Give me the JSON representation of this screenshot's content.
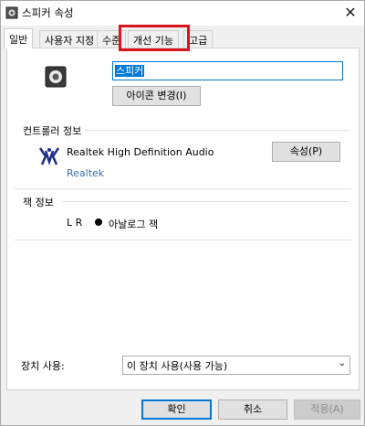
{
  "window": {
    "title": "스피커 속성",
    "close_glyph": "✕"
  },
  "tabs": [
    {
      "label": "일반",
      "active": true
    },
    {
      "label": "사용자 지정"
    },
    {
      "label": "수준"
    },
    {
      "label": "개선 기능",
      "highlighted": true
    },
    {
      "label": "고급"
    }
  ],
  "device": {
    "name_value": "스피커",
    "change_icon_label": "아이콘 변경(I)"
  },
  "controller": {
    "group_label": "컨트롤러 정보",
    "driver_name": "Realtek High Definition Audio",
    "vendor": "Realtek",
    "properties_label": "속성(P)"
  },
  "jack": {
    "group_label": "잭 정보",
    "position": "L R",
    "type": "아날로그 잭"
  },
  "device_usage": {
    "label": "장치 사용:",
    "selected": "이 장치 사용(사용 가능)"
  },
  "buttons": {
    "ok": "확인",
    "cancel": "취소",
    "apply": "적용(A)"
  },
  "colors": {
    "accent": "#0078d7",
    "highlight_border": "#d9141d",
    "vendor_link": "#3b6ea5"
  }
}
